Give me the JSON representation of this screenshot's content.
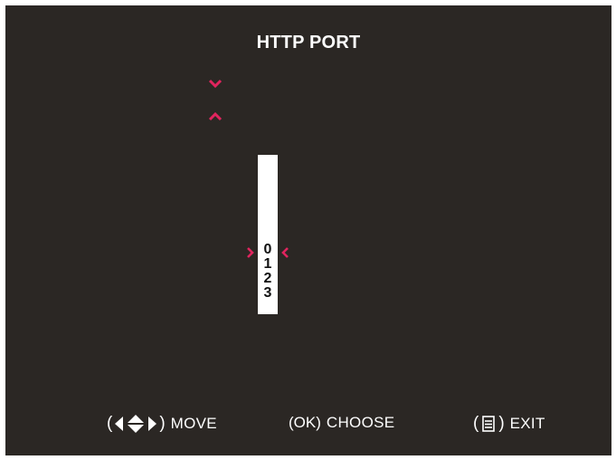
{
  "title": "HTTP PORT",
  "accent_color": "#e0245e",
  "icons": {
    "scroll_up": "chevron-down-icon",
    "scroll_down": "chevron-up-icon",
    "selector_left": "chevron-right-icon",
    "selector_right": "chevron-left-icon",
    "move": "four-direction-arrows-icon",
    "exit": "menu-icon"
  },
  "digit_picker": {
    "digits": [
      "0",
      "1",
      "2",
      "3"
    ],
    "selected": "0"
  },
  "footer": {
    "move": {
      "open": "(",
      "close": ")",
      "label": "MOVE"
    },
    "choose": {
      "key": "(OK)",
      "label": "CHOOSE"
    },
    "exit": {
      "open": "(",
      "close": ")",
      "label": "EXIT"
    }
  }
}
